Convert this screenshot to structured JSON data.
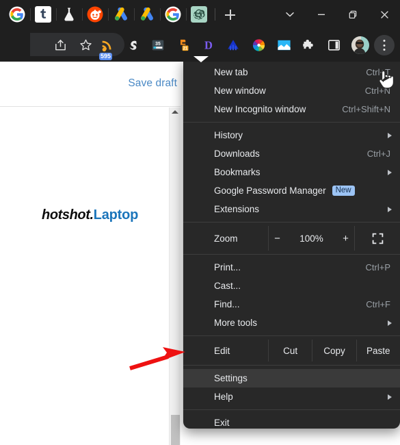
{
  "window": {
    "controls": [
      {
        "name": "tab-search-button",
        "glyph": "chevron-down"
      },
      {
        "name": "minimize-button",
        "glyph": "minimize"
      },
      {
        "name": "restore-button",
        "glyph": "restore"
      },
      {
        "name": "close-button",
        "glyph": "close"
      }
    ]
  },
  "tabstrip": {
    "pinned_tabs": [
      {
        "name": "tab-google",
        "icon": "google-icon"
      },
      {
        "name": "tab-tumblr",
        "icon": "tumblr-icon"
      },
      {
        "name": "tab-lab",
        "icon": "flask-icon"
      },
      {
        "name": "tab-reddit",
        "icon": "reddit-icon"
      },
      {
        "name": "tab-google-ads-1",
        "icon": "google-ads-icon"
      },
      {
        "name": "tab-google-ads-2",
        "icon": "google-ads-icon"
      },
      {
        "name": "tab-google-search",
        "icon": "google-icon"
      },
      {
        "name": "tab-openai",
        "icon": "openai-icon"
      }
    ],
    "new_tab_label": "+"
  },
  "toolbar": {
    "share_icon": "share-icon",
    "bookmark_icon": "star-icon",
    "extensions": [
      {
        "name": "rss-extension",
        "icon": "rss-icon",
        "badge": "595"
      },
      {
        "name": "similarweb-extension",
        "icon": "s-swirl-icon",
        "badge": ""
      },
      {
        "name": "metrics-extension",
        "icon": "meter-icon",
        "badge": "35"
      },
      {
        "name": "seo-extension",
        "icon": "orange-tag-icon",
        "badge": "21"
      },
      {
        "name": "d-extension",
        "icon": "letter-d-icon",
        "badge": ""
      },
      {
        "name": "analytics-extension",
        "icon": "triangle-blue-icon",
        "badge": ""
      },
      {
        "name": "colorwheel-extension",
        "icon": "color-wheel-icon",
        "badge": ""
      },
      {
        "name": "image-extension",
        "icon": "picture-icon",
        "badge": ""
      },
      {
        "name": "extensions-puzzle",
        "icon": "puzzle-icon",
        "badge": ""
      },
      {
        "name": "sidepanel-button",
        "icon": "side-panel-icon",
        "badge": ""
      }
    ],
    "profile_icon": "avatar-icon",
    "menu_icon": "three-dot-menu-icon"
  },
  "page": {
    "save_draft_label": "Save draft",
    "logo_part1": "hotshot.",
    "logo_part2": "Laptop"
  },
  "menu": {
    "groups": [
      {
        "items": [
          {
            "name": "menu-item-new-tab",
            "label": "New tab",
            "accel": "Ctrl+T",
            "submenu": false,
            "highlight": false,
            "badge": ""
          },
          {
            "name": "menu-item-new-window",
            "label": "New window",
            "accel": "Ctrl+N",
            "submenu": false,
            "highlight": false,
            "badge": ""
          },
          {
            "name": "menu-item-new-incognito-window",
            "label": "New Incognito window",
            "accel": "Ctrl+Shift+N",
            "submenu": false,
            "highlight": false,
            "badge": ""
          }
        ]
      },
      {
        "items": [
          {
            "name": "menu-item-history",
            "label": "History",
            "accel": "",
            "submenu": true,
            "highlight": false,
            "badge": ""
          },
          {
            "name": "menu-item-downloads",
            "label": "Downloads",
            "accel": "Ctrl+J",
            "submenu": false,
            "highlight": false,
            "badge": ""
          },
          {
            "name": "menu-item-bookmarks",
            "label": "Bookmarks",
            "accel": "",
            "submenu": true,
            "highlight": false,
            "badge": ""
          },
          {
            "name": "menu-item-google-password-manager",
            "label": "Google Password Manager",
            "accel": "",
            "submenu": false,
            "highlight": false,
            "badge": "New"
          },
          {
            "name": "menu-item-extensions",
            "label": "Extensions",
            "accel": "",
            "submenu": true,
            "highlight": false,
            "badge": ""
          }
        ]
      }
    ],
    "zoom_row": {
      "label": "Zoom",
      "minus_label": "−",
      "value": "100%",
      "plus_label": "+",
      "fullscreen_icon": "fullscreen-icon"
    },
    "group3": {
      "items": [
        {
          "name": "menu-item-print",
          "label": "Print...",
          "accel": "Ctrl+P",
          "submenu": false
        },
        {
          "name": "menu-item-cast",
          "label": "Cast...",
          "accel": "",
          "submenu": false
        },
        {
          "name": "menu-item-find",
          "label": "Find...",
          "accel": "Ctrl+F",
          "submenu": false
        },
        {
          "name": "menu-item-more-tools",
          "label": "More tools",
          "accel": "",
          "submenu": true
        }
      ]
    },
    "edit_row": {
      "label": "Edit",
      "cut_label": "Cut",
      "copy_label": "Copy",
      "paste_label": "Paste"
    },
    "group4": {
      "items": [
        {
          "name": "menu-item-settings",
          "label": "Settings",
          "accel": "",
          "submenu": false,
          "highlight": true
        },
        {
          "name": "menu-item-help",
          "label": "Help",
          "accel": "",
          "submenu": true,
          "highlight": false
        }
      ]
    },
    "group5": {
      "items": [
        {
          "name": "menu-item-exit",
          "label": "Exit",
          "accel": "",
          "submenu": false,
          "highlight": false
        }
      ]
    }
  },
  "annotation": {
    "arrow_color": "#ee1111",
    "points_to": "menu-item-settings"
  }
}
